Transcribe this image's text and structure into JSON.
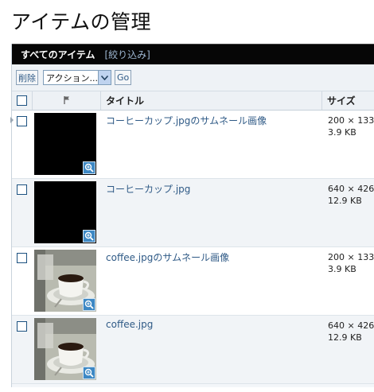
{
  "page": {
    "title": "アイテムの管理"
  },
  "panel": {
    "title": "すべてのアイテム",
    "filter_link": "[絞り込み]"
  },
  "toolbar": {
    "delete_label": "削除",
    "action_select": {
      "selected": "アクション..."
    },
    "go_label": "Go"
  },
  "table": {
    "headers": {
      "title": "タイトル",
      "size": "サイズ"
    },
    "rows": [
      {
        "title": "コーヒーカップ.jpgのサムネール画像",
        "dimensions": "200 × 133",
        "filesize": "3.9 KB",
        "thumbnail": "black"
      },
      {
        "title": "コーヒーカップ.jpg",
        "dimensions": "640 × 426",
        "filesize": "12.9 KB",
        "thumbnail": "black"
      },
      {
        "title": "coffee.jpgのサムネール画像",
        "dimensions": "200 × 133",
        "filesize": "3.9 KB",
        "thumbnail": "coffee-photo"
      },
      {
        "title": "coffee.jpg",
        "dimensions": "640 × 426",
        "filesize": "12.9 KB",
        "thumbnail": "coffee-photo"
      }
    ]
  },
  "colors": {
    "link": "#2f5a86",
    "header_bg": "#060606",
    "zoom_bg": "#3d88c4"
  },
  "icons": {
    "flag_header": "flag-icon",
    "zoom": "magnifier-zoom-icon",
    "select_arrow": "chevron-down-icon"
  }
}
